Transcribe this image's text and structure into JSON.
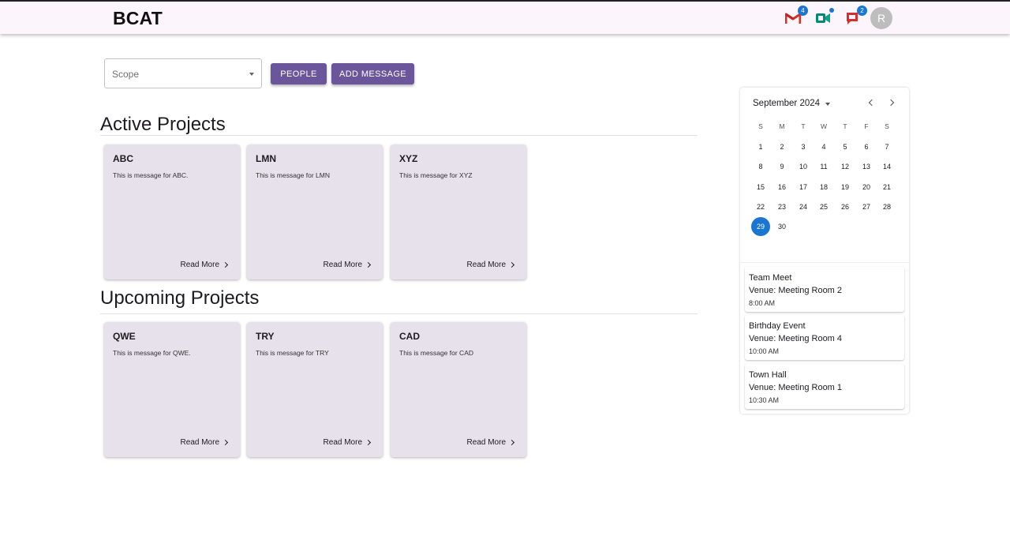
{
  "header": {
    "brand": "BCAT",
    "gmail_badge": "4",
    "chat_badge": "2",
    "avatar_initial": "R"
  },
  "colors": {
    "primary_button": "#6b559b",
    "card_bg": "#e7e1ec",
    "accent": "#1976d2",
    "header_bg": "#fcf5fc"
  },
  "toolbar": {
    "scope_placeholder": "Scope",
    "people_label": "PEOPLE",
    "add_message_label": "ADD MESSAGE"
  },
  "active_projects": {
    "title": "Active Projects",
    "cards": [
      {
        "title": "ABC",
        "message": "This is message for ABC.",
        "link": "Read More"
      },
      {
        "title": "LMN",
        "message": "This is message for LMN",
        "link": "Read More"
      },
      {
        "title": "XYZ",
        "message": "This is message for XYZ",
        "link": "Read More"
      }
    ]
  },
  "upcoming_projects": {
    "title": "Upcoming Projects",
    "cards": [
      {
        "title": "QWE",
        "message": "This is message for QWE.",
        "link": "Read More"
      },
      {
        "title": "TRY",
        "message": "This is message for TRY",
        "link": "Read More"
      },
      {
        "title": "CAD",
        "message": "This is message for CAD",
        "link": "Read More"
      }
    ]
  },
  "calendar": {
    "month_label": "September 2024",
    "weekdays": [
      "S",
      "M",
      "T",
      "W",
      "T",
      "F",
      "S"
    ],
    "days": [
      "1",
      "2",
      "3",
      "4",
      "5",
      "6",
      "7",
      "8",
      "9",
      "10",
      "11",
      "12",
      "13",
      "14",
      "15",
      "16",
      "17",
      "18",
      "19",
      "20",
      "21",
      "22",
      "23",
      "24",
      "25",
      "26",
      "27",
      "28",
      "29",
      "30"
    ],
    "selected_day": "29"
  },
  "events": [
    {
      "name": "Team Meet",
      "venue": "Venue: Meeting Room 2",
      "time": "8:00 AM"
    },
    {
      "name": "Birthday Event",
      "venue": "Venue: Meeting Room 4",
      "time": "10:00 AM"
    },
    {
      "name": "Town Hall",
      "venue": "Venue: Meeting Room 1",
      "time": "10:30 AM"
    }
  ]
}
